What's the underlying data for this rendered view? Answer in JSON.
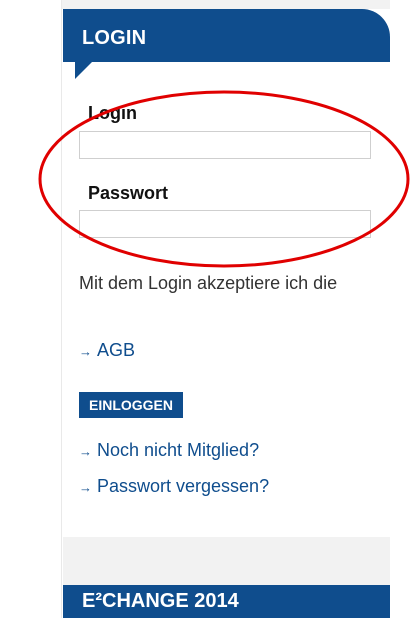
{
  "login": {
    "header_title": "LOGIN",
    "login_label": "Login",
    "login_value": "",
    "password_label": "Passwort",
    "password_value": "",
    "terms_text": "Mit dem Login akzeptiere ich die",
    "agb_link": "AGB",
    "submit_button": "EINLOGGEN",
    "register_link": "Noch nicht Mitglied?",
    "forgot_password_link": "Passwort vergessen?"
  },
  "bottom_section": {
    "title": "E²CHANGE 2014"
  },
  "icons": {
    "link_arrow": "arrow-right-icon"
  },
  "colors": {
    "brand_blue": "#0f4d8d",
    "annotation_red": "#e00000",
    "panel_gray": "#f2f2f2",
    "text": "#333333"
  }
}
